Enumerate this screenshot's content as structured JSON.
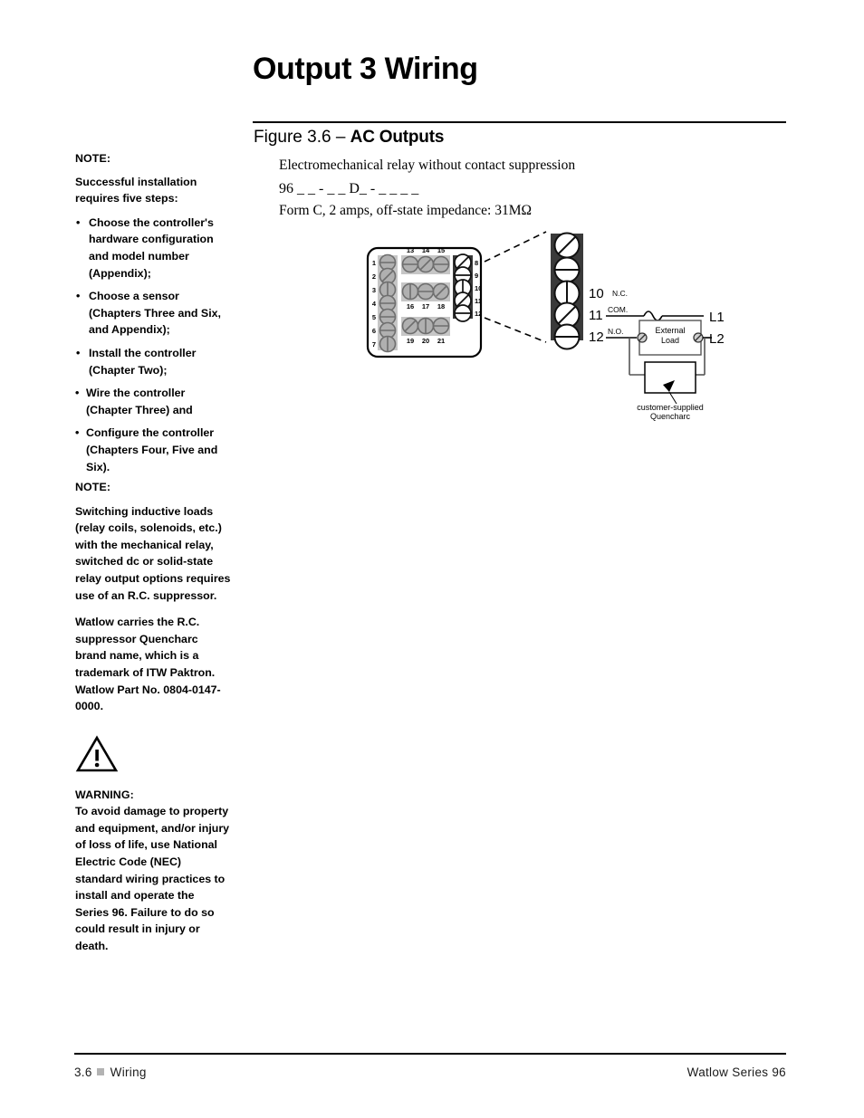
{
  "page": {
    "title": "Output 3 Wiring"
  },
  "figure": {
    "label": "Figure 3.6 – ",
    "name": "AC Outputs",
    "description": "Electromechanical relay without contact suppression",
    "model_number": "96 _ _ - _ _ D_ - _ _ _ _",
    "specs": "Form C, 2 amps, off-state impedance: 31MΩ"
  },
  "sidebar": {
    "note1": {
      "header": "NOTE:",
      "intro": "Successful installation requires five steps:",
      "bullet_char": "•",
      "items": [
        "Choose the controller's hardware configuration and model number (Appendix);",
        "Choose a sensor (Chapters Three and Six, and Appendix);",
        "Install the controller (Chapter Two);",
        "Wire the controller (Chapter Three) and",
        "Configure the controller (Chapters Four, Five and Six)."
      ]
    },
    "note2": {
      "header": "NOTE:",
      "para1": "Switching inductive loads (relay coils, solenoids, etc.) with the mechanical relay, switched dc or solid-state relay output options requires use of an R.C. suppressor.",
      "para2": "Watlow carries the R.C. suppressor Quencharc brand name, which is a trademark of ITW Paktron. Watlow Part No. 0804-0147-0000."
    },
    "warning": {
      "icon": "warning-triangle-icon",
      "header": "WARNING:",
      "body": "To avoid damage to property and equipment, and/or injury of loss of life, use National Electric Code (NEC) standard wiring practices to install and operate the Series 96. Failure to do so could result in injury or death."
    }
  },
  "footer": {
    "left_section": "3.6",
    "left_label": "Wiring",
    "right_label": "Watlow Series 96"
  },
  "diagram": {
    "controller": {
      "left_column_terminals": [
        "1",
        "2",
        "3",
        "4",
        "5",
        "6",
        "7"
      ],
      "row1_terminals": [
        "13",
        "14",
        "15"
      ],
      "row2_terminals": [
        "16",
        "17",
        "18"
      ],
      "row3_terminals": [
        "19",
        "20",
        "21"
      ],
      "dark_block_terminals": [
        "8",
        "9",
        "10",
        "11",
        "12"
      ]
    },
    "detail": {
      "terminals": [
        "10",
        "11",
        "12"
      ],
      "contact_labels": [
        "N.C.",
        "COM.",
        "N.O."
      ],
      "line_labels": [
        "L1",
        "L2"
      ],
      "load_label_line1": "External",
      "load_label_line2": "Load",
      "quencharc_caption_line1": "customer-supplied",
      "quencharc_caption_line2": "Quencharc"
    },
    "colors": {
      "dark_block": "#3a3a3a",
      "light_strip": "#c6c6c6",
      "screw_fill": "#b0b0b0",
      "wire": "#4d4d4d"
    }
  }
}
